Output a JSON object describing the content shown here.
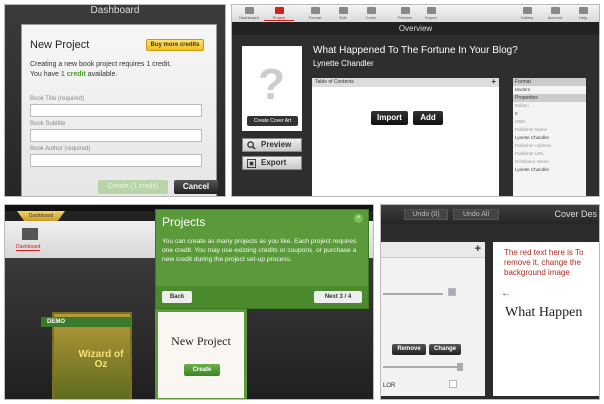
{
  "panel1": {
    "header_title": "Dashboard",
    "dialog_title": "New Project",
    "buy_label": "Buy more credits",
    "line1": "Creating a new book project requires 1 credit.",
    "line2_pre": "You have ",
    "line2_credit": "1 credit",
    "line2_post": " available.",
    "fields": [
      {
        "label": "Book Title (required)"
      },
      {
        "label": "Book Subtitle"
      },
      {
        "label": "Book Author (required)"
      }
    ],
    "create_label": "Create (1 credit)",
    "cancel_label": "Cancel"
  },
  "panel2": {
    "toolbar_left": [
      {
        "label": "Dashboard",
        "active": false
      },
      {
        "label": "Project",
        "active": true
      },
      {
        "label": "Format",
        "active": false
      },
      {
        "label": "Edit",
        "active": false
      },
      {
        "label": "Cover",
        "active": false
      },
      {
        "label": "Preview",
        "active": false
      },
      {
        "label": "Export",
        "active": false
      }
    ],
    "toolbar_right": [
      {
        "label": "Gallery"
      },
      {
        "label": "Account"
      },
      {
        "label": "Help"
      }
    ],
    "section_title": "Overview",
    "cover_glyph": "?",
    "create_cover_label": "Create Cover Art",
    "preview_label": "Preview",
    "export_label": "Export",
    "book_title": "What Happened To The Fortune In Your Blog?",
    "book_author": "Lynette Chandler",
    "toc_header": "Table of Contents",
    "toc_plus": "+",
    "import_label": "Import",
    "add_label": "Add",
    "props": [
      {
        "text": "Format",
        "kind": "head"
      },
      {
        "text": "Modern",
        "kind": "value"
      },
      {
        "text": "Properties",
        "kind": "head"
      },
      {
        "text": "Edition",
        "kind": "label"
      },
      {
        "text": "0",
        "kind": "value"
      },
      {
        "text": "ISBN",
        "kind": "label"
      },
      {
        "text": "Publisher Name",
        "kind": "label"
      },
      {
        "text": "Lynette Chandler",
        "kind": "value"
      },
      {
        "text": "Publisher Address",
        "kind": "label"
      },
      {
        "text": "Publisher URL",
        "kind": "label"
      },
      {
        "text": "Distributor Name",
        "kind": "label"
      },
      {
        "text": "Lynette Chandler",
        "kind": "value"
      }
    ]
  },
  "panel3": {
    "dashboard_tab": "Dashboard",
    "nav_label": "Dashboard",
    "demo_label": "DEMO",
    "thumb_text": "Wizard of Oz",
    "new_project_title": "New Project",
    "create_label": "Create",
    "tip_title": "Projects",
    "tip_close": "×",
    "tip_body": "You can create as many projects as you like. Each project requires one credit. You may use existing credits or coupons, or purchase a new credit during the project set-up process.",
    "back_label": "Back",
    "next_label": "Next 3 / 4"
  },
  "panel4": {
    "undo_label": "Undo (0)",
    "undo_all_label": "Undo All",
    "title": "Cover Des",
    "plus": "+",
    "remove_label": "Remove",
    "change_label": "Change",
    "color_label": "LOR",
    "hint_text": "The red text here is To remove it, change the background image",
    "arrow": "←",
    "preview_title": "What Happen"
  }
}
